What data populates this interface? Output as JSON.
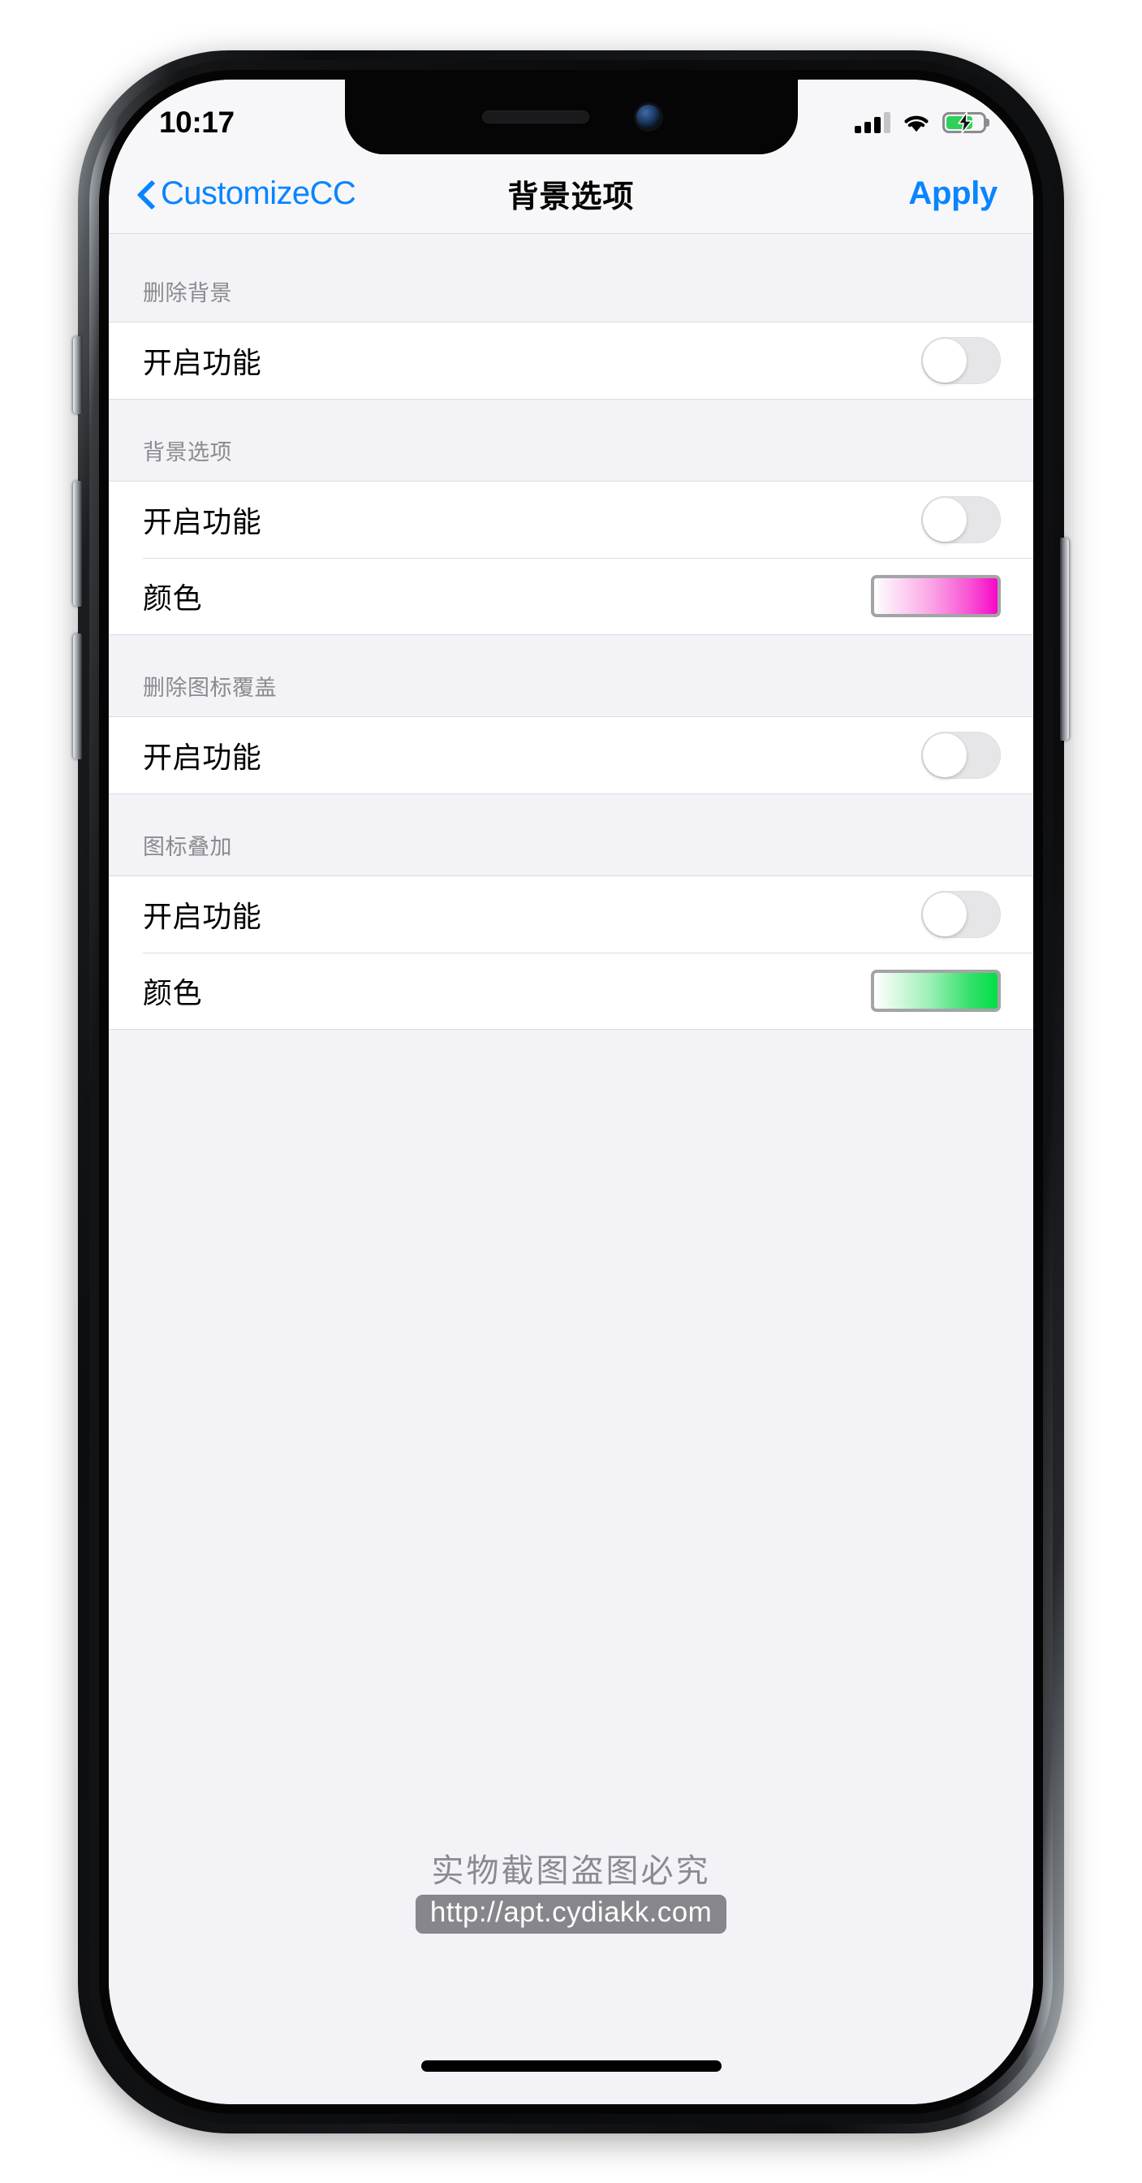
{
  "status_bar": {
    "time": "10:17",
    "signal_icon": "cellular-signal-icon",
    "signal_bars_filled": 3,
    "signal_bars_total": 4,
    "wifi_icon": "wifi-icon",
    "battery_icon": "battery-charging-icon",
    "battery_level_percent": 72,
    "battery_color": "#2fd159"
  },
  "nav": {
    "back_label": "CustomizeCC",
    "back_icon": "chevron-left-icon",
    "title": "背景选项",
    "apply_label": "Apply",
    "accent_color": "#0a84ff"
  },
  "sections": [
    {
      "header": "删除背景",
      "rows": [
        {
          "label": "开启功能",
          "control": "toggle",
          "value": "off"
        }
      ]
    },
    {
      "header": "背景选项",
      "rows": [
        {
          "label": "开启功能",
          "control": "toggle",
          "value": "off"
        },
        {
          "label": "颜色",
          "control": "swatch",
          "swatch": "pink",
          "color_from": "#ffffff",
          "color_to": "#f707c8"
        }
      ]
    },
    {
      "header": "删除图标覆盖",
      "rows": [
        {
          "label": "开启功能",
          "control": "toggle",
          "value": "off"
        }
      ]
    },
    {
      "header": "图标叠加",
      "rows": [
        {
          "label": "开启功能",
          "control": "toggle",
          "value": "off"
        },
        {
          "label": "颜色",
          "control": "swatch",
          "swatch": "green",
          "color_from": "#ffffff",
          "color_to": "#00e044"
        }
      ]
    }
  ],
  "watermark": {
    "text": "实物截图盗图必究",
    "url": "http://apt.cydiakk.com"
  }
}
